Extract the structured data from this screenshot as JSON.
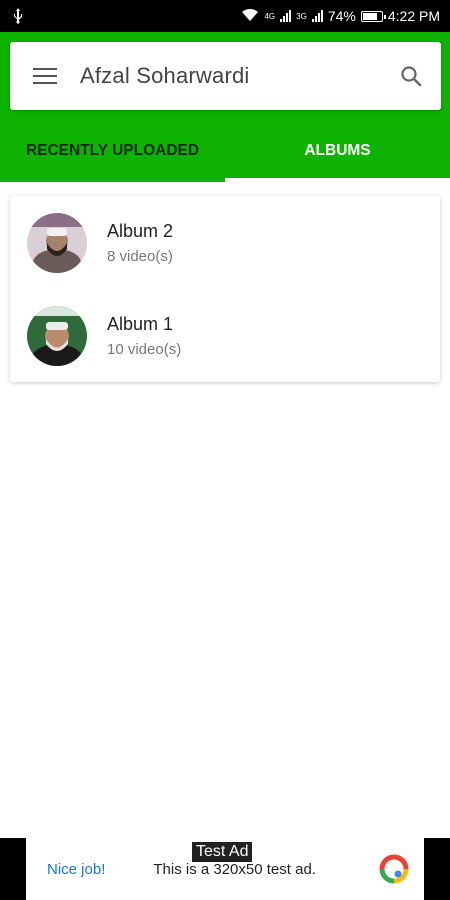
{
  "status_bar": {
    "battery": "74%",
    "time": "4:22 PM",
    "net_a": "4G",
    "net_b": "3G",
    "icons": [
      "usb-icon",
      "wifi-icon",
      "signal-icon",
      "battery-icon"
    ]
  },
  "header": {
    "title": "Afzal Soharwardi",
    "menu_icon": "hamburger-menu-icon",
    "search_icon": "search-icon"
  },
  "tabs": [
    {
      "label": "RECENTLY UPLOADED",
      "active": false
    },
    {
      "label": "ALBUMS",
      "active": true
    }
  ],
  "albums": [
    {
      "name": "Album 2",
      "count": "8 video(s)"
    },
    {
      "name": "Album 1",
      "count": "10 video(s)"
    }
  ],
  "ad": {
    "tag": "Test Ad",
    "nice_label": "Nice job!",
    "description": "This is a 320x50 test ad."
  },
  "colors": {
    "accent": "#0db300",
    "tab_inactive": "#0b2b08",
    "link": "#1a73e8"
  }
}
